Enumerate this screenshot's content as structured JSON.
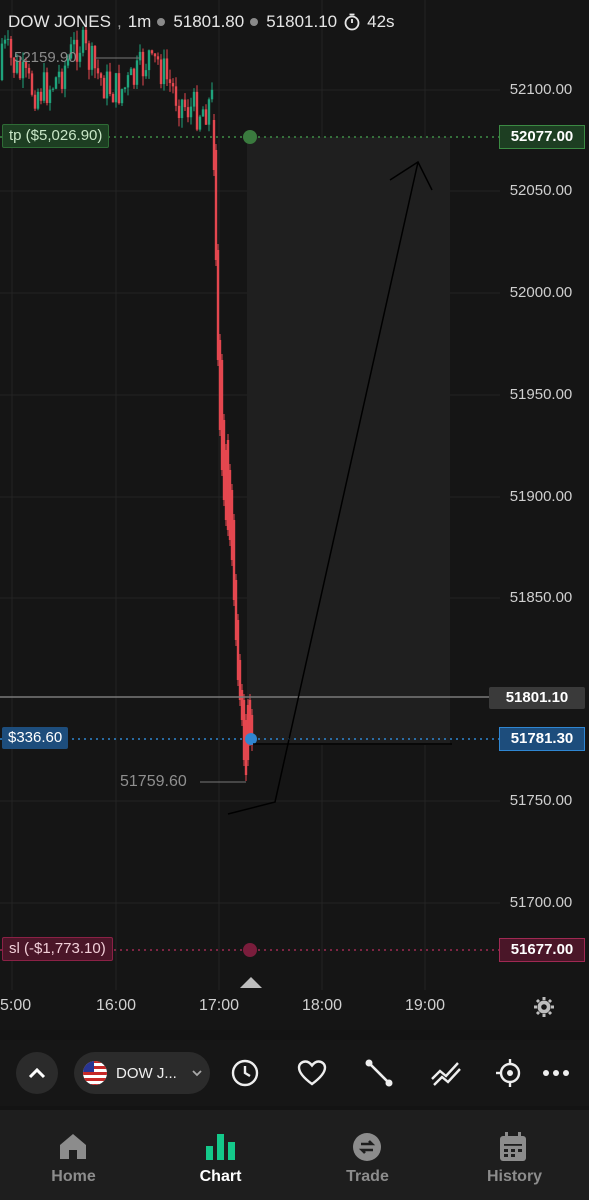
{
  "header": {
    "symbol": "DOW JONES",
    "timeframe": "1m",
    "bid": "51801.80",
    "ask": "51801.10",
    "countdown": "42s"
  },
  "price_axis": [
    "52100.00",
    "52050.00",
    "52000.00",
    "51950.00",
    "51900.00",
    "51850.00",
    "51750.00",
    "51700.00"
  ],
  "time_axis": [
    "5:00",
    "16:00",
    "17:00",
    "18:00",
    "19:00"
  ],
  "high_marker": "52159.90",
  "low_marker": "51759.60",
  "take_profit": {
    "label": "tp ($5,026.90)",
    "price": "52077.00",
    "color": "#2e7d32"
  },
  "stop_loss": {
    "label": "sl (-$1,773.10)",
    "price": "51677.00",
    "color": "#a02953"
  },
  "position": {
    "label": "$336.60",
    "price": "51781.30",
    "color": "#2f86d2"
  },
  "last_price": "51801.10",
  "toolbar": {
    "collapse_icon": "chevron-up-icon",
    "symbol_label": "DOW J...",
    "flag_icon": "us-flag-icon",
    "clock_icon": "clock-icon",
    "favorite_icon": "heart-icon",
    "line_tool_icon": "trend-line-icon",
    "indicator_icon": "indicator-icon",
    "crosshair_icon": "crosshair-icon",
    "more_icon": "more-icon"
  },
  "nav": {
    "home": "Home",
    "chart": "Chart",
    "trade": "Trade",
    "history": "History"
  }
}
